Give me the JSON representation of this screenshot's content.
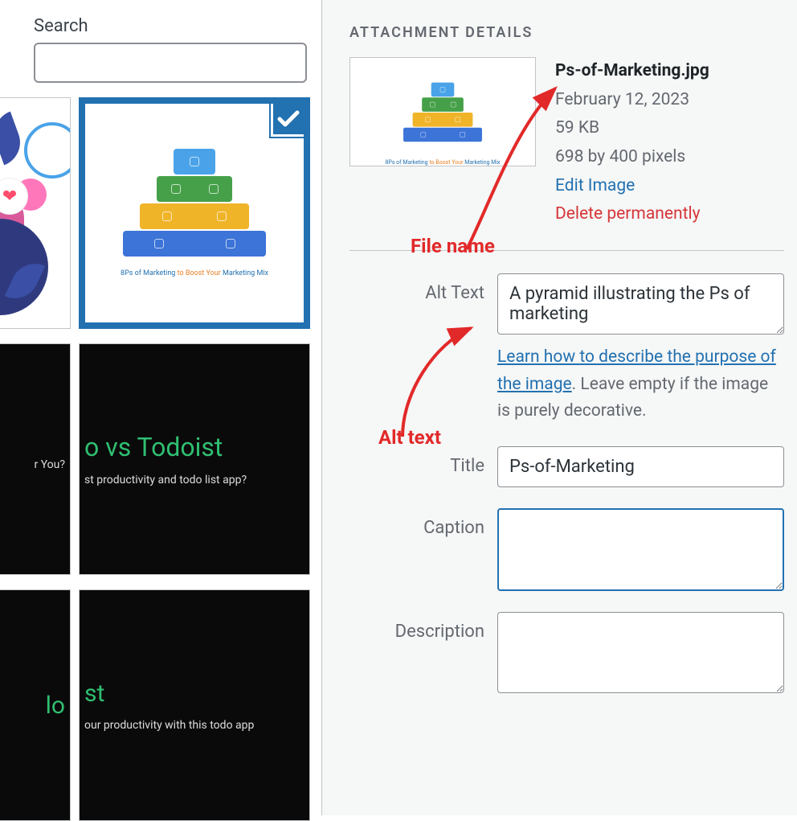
{
  "search": {
    "label": "Search",
    "value": ""
  },
  "thumbs": {
    "pyramid_caption_part1": "8Ps of Marketing",
    "pyramid_caption_part2": " to Boost Your ",
    "pyramid_caption_part3": "Marketing Mix",
    "black1_title": "o vs Todoist",
    "black1_sub_left": "r You?",
    "black1_sub": "st productivity and todo list app?",
    "black2_title_left": "lo",
    "black2_title_right": "st",
    "black2_sub": "our productivity with this todo app"
  },
  "panel": {
    "heading": "ATTACHMENT DETAILS",
    "filename": "Ps-of-Marketing.jpg",
    "date": "February 12, 2023",
    "size": "59 KB",
    "dimensions": "698 by 400 pixels",
    "edit_label": "Edit Image",
    "delete_label": "Delete permanently"
  },
  "fields": {
    "alt_label": "Alt Text",
    "alt_value": "A pyramid illustrating the Ps of marketing",
    "alt_help_link": "Learn how to describe the purpose of the image",
    "alt_help_rest": ". Leave empty if the image is purely decorative.",
    "title_label": "Title",
    "title_value": "Ps-of-Marketing",
    "caption_label": "Caption",
    "caption_value": "",
    "description_label": "Description",
    "description_value": ""
  },
  "annotations": {
    "file_name": "File name",
    "alt_text": "Alt text"
  }
}
